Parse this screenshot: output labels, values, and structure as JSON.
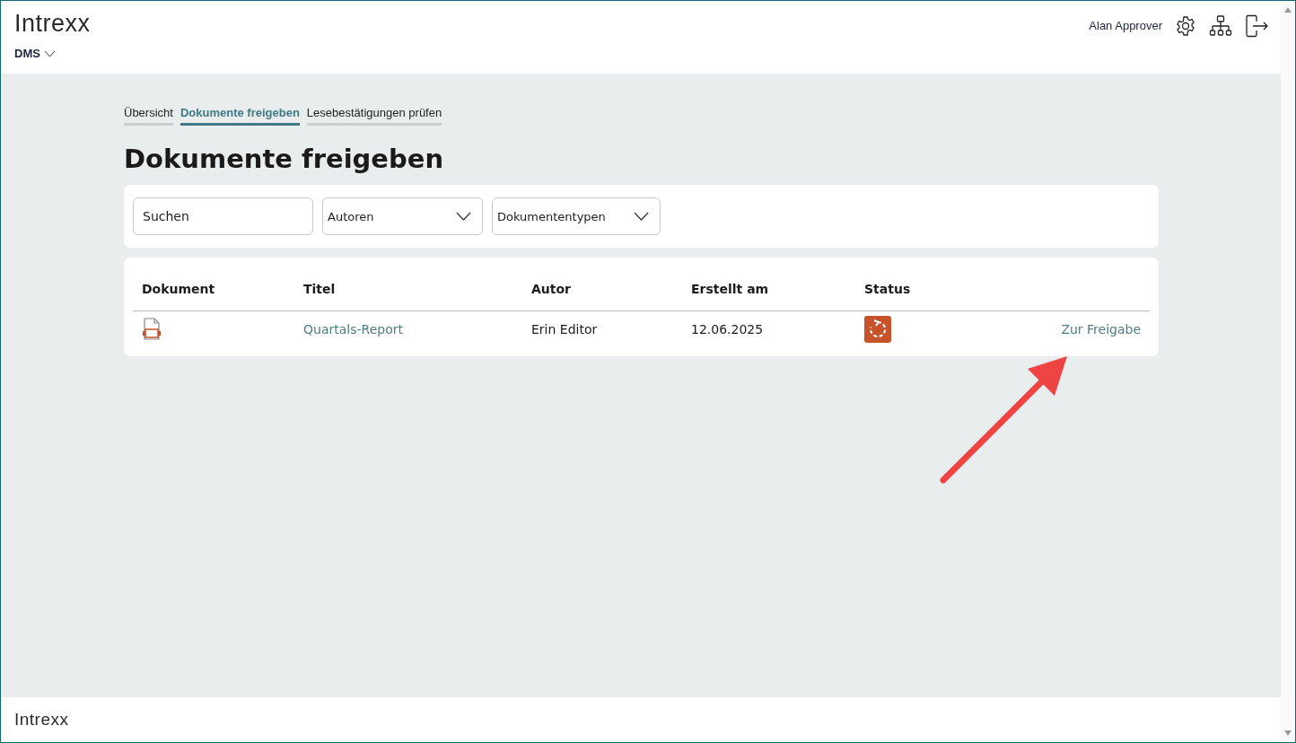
{
  "header": {
    "logo": "Intrexx",
    "app_menu": "DMS",
    "user": "Alan Approver"
  },
  "tabs": [
    {
      "label": "Übersicht",
      "selected": false
    },
    {
      "label": "Dokumente freigeben",
      "selected": true
    },
    {
      "label": "Lesebestätigungen prüfen",
      "selected": false
    }
  ],
  "page_title": "Dokumente freigeben",
  "filters": {
    "search": {
      "placeholder": "Suchen"
    },
    "dropdowns": [
      "Autoren",
      "Dokumententypen"
    ]
  },
  "table": {
    "columns": [
      "Dokument",
      "Titel",
      "Autor",
      "Erstellt am",
      "Status"
    ],
    "rows": [
      {
        "title": "Quartals-Report",
        "author": "Erin Editor",
        "created": "12.06.2025",
        "action": "Zur Freigabe"
      }
    ]
  },
  "footer": {
    "logo": "Intrexx"
  }
}
